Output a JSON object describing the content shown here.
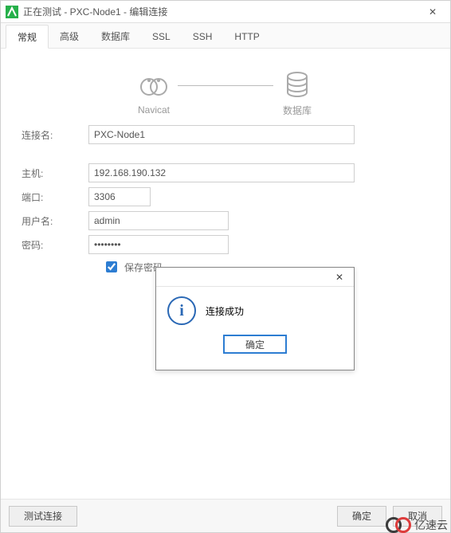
{
  "title": "正在测试 - PXC-Node1 - 编辑连接",
  "close_glyph": "✕",
  "tabs": [
    {
      "label": "常规",
      "active": true
    },
    {
      "label": "高级",
      "active": false
    },
    {
      "label": "数据库",
      "active": false
    },
    {
      "label": "SSL",
      "active": false
    },
    {
      "label": "SSH",
      "active": false
    },
    {
      "label": "HTTP",
      "active": false
    }
  ],
  "diagram": {
    "left": "Navicat",
    "right": "数据库"
  },
  "form": {
    "conn_name_label": "连接名:",
    "conn_name_value": "PXC-Node1",
    "host_label": "主机:",
    "host_value": "192.168.190.132",
    "port_label": "端口:",
    "port_value": "3306",
    "user_label": "用户名:",
    "user_value": "admin",
    "pass_label": "密码:",
    "pass_value": "••••••••",
    "save_pass_label": "保存密码",
    "save_pass_checked": true
  },
  "dialog": {
    "info_glyph": "i",
    "message": "连接成功",
    "ok_label": "确定",
    "close_glyph": "✕"
  },
  "footer": {
    "test_label": "测试连接",
    "ok_label": "确定",
    "cancel_label": "取消"
  },
  "watermark": "亿速云"
}
